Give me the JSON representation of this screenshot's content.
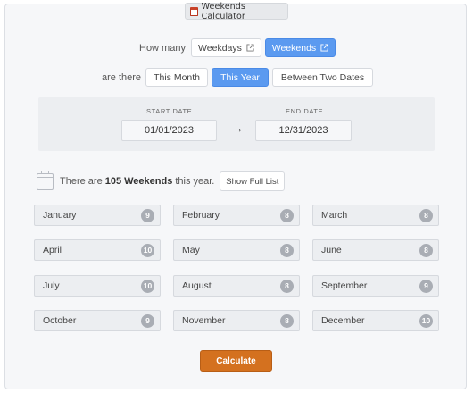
{
  "app": {
    "title": "Weekends Calculator"
  },
  "selector": {
    "how_many_label": "How many",
    "weekdays_label": "Weekdays",
    "weekends_label": "Weekends",
    "are_there_label": "are there",
    "this_month_label": "This Month",
    "this_year_label": "This Year",
    "between_label": "Between Two Dates"
  },
  "dates": {
    "start_label": "START DATE",
    "start_value": "01/01/2023",
    "arrow": "→",
    "end_label": "END DATE",
    "end_value": "12/31/2023"
  },
  "summary": {
    "prefix": "There are",
    "count_text": "105 Weekends",
    "suffix": "this year.",
    "show_list_label": "Show Full List"
  },
  "months": [
    {
      "name": "January",
      "count": "9"
    },
    {
      "name": "February",
      "count": "8"
    },
    {
      "name": "March",
      "count": "8"
    },
    {
      "name": "April",
      "count": "10"
    },
    {
      "name": "May",
      "count": "8"
    },
    {
      "name": "June",
      "count": "8"
    },
    {
      "name": "July",
      "count": "10"
    },
    {
      "name": "August",
      "count": "8"
    },
    {
      "name": "September",
      "count": "9"
    },
    {
      "name": "October",
      "count": "9"
    },
    {
      "name": "November",
      "count": "8"
    },
    {
      "name": "December",
      "count": "10"
    }
  ],
  "calculate_label": "Calculate",
  "colors": {
    "accent": "#5b9af0",
    "calculate": "#d4711f",
    "badge": "#a9adb4"
  }
}
